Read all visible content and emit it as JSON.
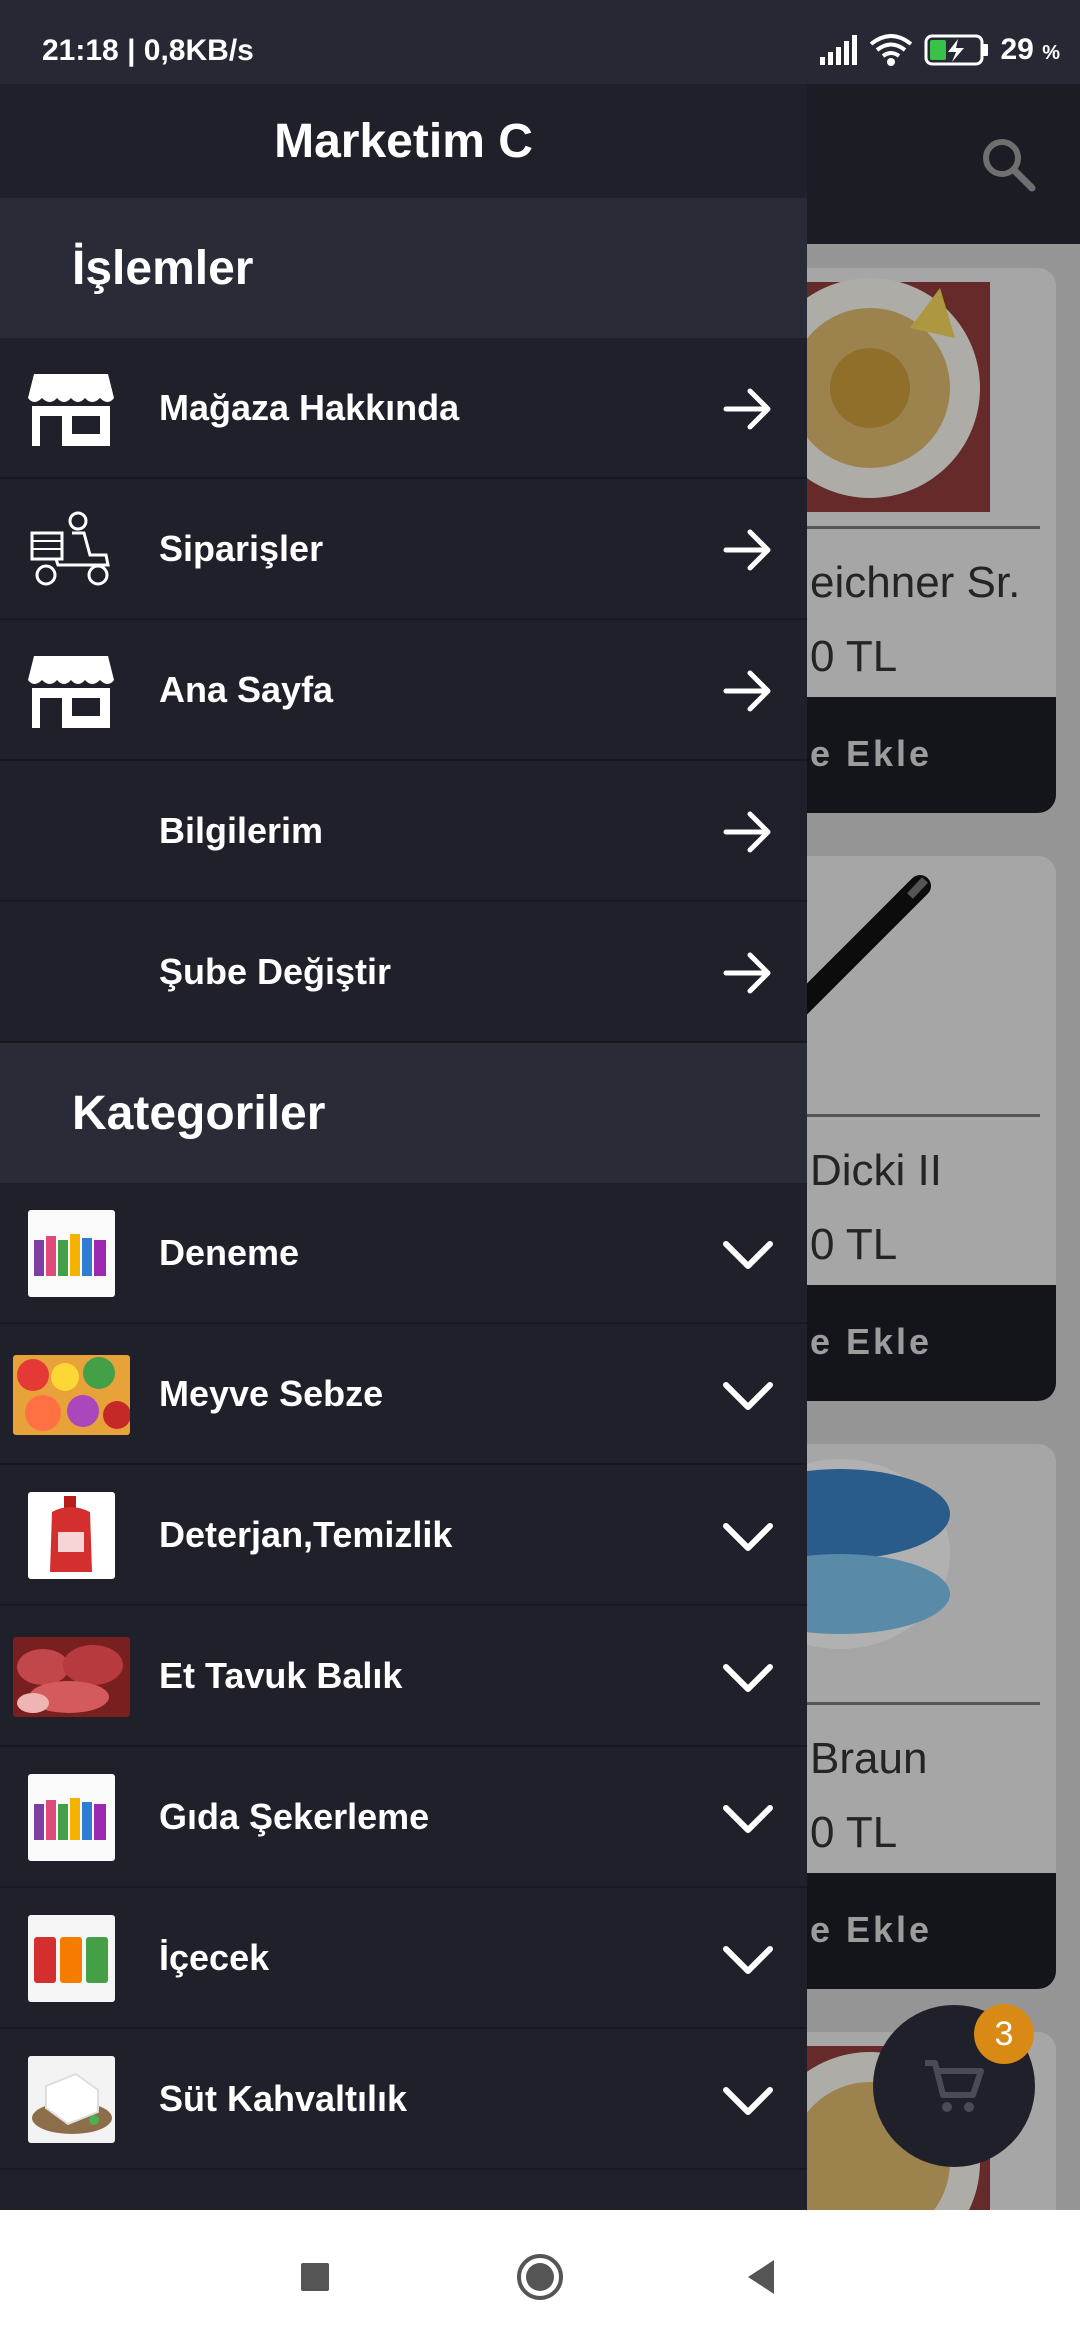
{
  "status_bar": {
    "time_speed": "21:18 | 0,8KB/s",
    "battery": "29",
    "battery_unit": "%"
  },
  "drawer": {
    "title": "Marketim C",
    "operations_header": "İşlemler",
    "operations": [
      {
        "label": "Mağaza Hakkında",
        "icon": "store-icon"
      },
      {
        "label": "Siparişler",
        "icon": "delivery-scooter-icon"
      },
      {
        "label": "Ana Sayfa",
        "icon": "store-icon"
      },
      {
        "label": "Bilgilerim",
        "icon": ""
      },
      {
        "label": "Şube Değiştir",
        "icon": ""
      }
    ],
    "categories_header": "Kategoriler",
    "categories": [
      {
        "label": "Deneme",
        "thumb": "bottles-thumb"
      },
      {
        "label": "Meyve Sebze",
        "thumb": "fruits-thumb"
      },
      {
        "label": "Deterjan,Temizlik",
        "thumb": "detergent-thumb"
      },
      {
        "label": "Et Tavuk Balık",
        "thumb": "meat-thumb"
      },
      {
        "label": "Gıda Şekerleme",
        "thumb": "bottles-thumb"
      },
      {
        "label": "İçecek",
        "thumb": "cans-thumb"
      },
      {
        "label": "Süt Kahvaltılık",
        "thumb": "cheese-thumb"
      }
    ]
  },
  "background": {
    "cards": [
      {
        "title": "eichner Sr.",
        "price": "0 TL",
        "button": "e Ekle"
      },
      {
        "title": "Dicki II",
        "price": "0 TL",
        "button": "e Ekle"
      },
      {
        "title": "Braun",
        "price": "0 TL",
        "button": "e Ekle"
      }
    ],
    "cart_badge": "3"
  },
  "colors": {
    "drawer_bg": "#1f2029",
    "section_bg": "#292b36",
    "badge": "#d98a14"
  }
}
